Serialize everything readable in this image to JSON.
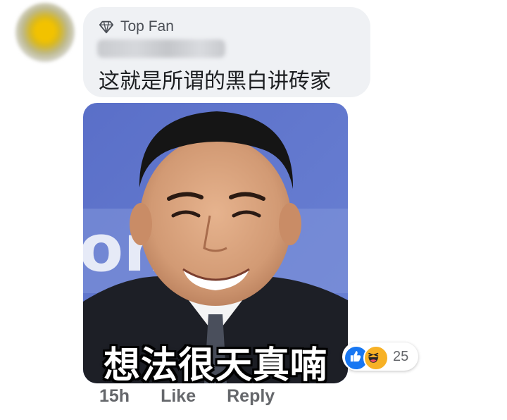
{
  "comment": {
    "badge": {
      "label": "Top Fan",
      "icon": "diamond-icon"
    },
    "text": "这就是所谓的黑白讲砖家"
  },
  "meme": {
    "caption": "想法很天真喃",
    "background_text": "one"
  },
  "reactions": {
    "icons": [
      "like-reaction-icon",
      "haha-reaction-icon"
    ],
    "count": "25"
  },
  "actions": {
    "time": "15h",
    "like_label": "Like",
    "reply_label": "Reply"
  },
  "colors": {
    "bubble": "#eff1f4",
    "action_text": "#65676b",
    "like_blue": "#1877f2",
    "haha_yellow": "#f7b125"
  }
}
